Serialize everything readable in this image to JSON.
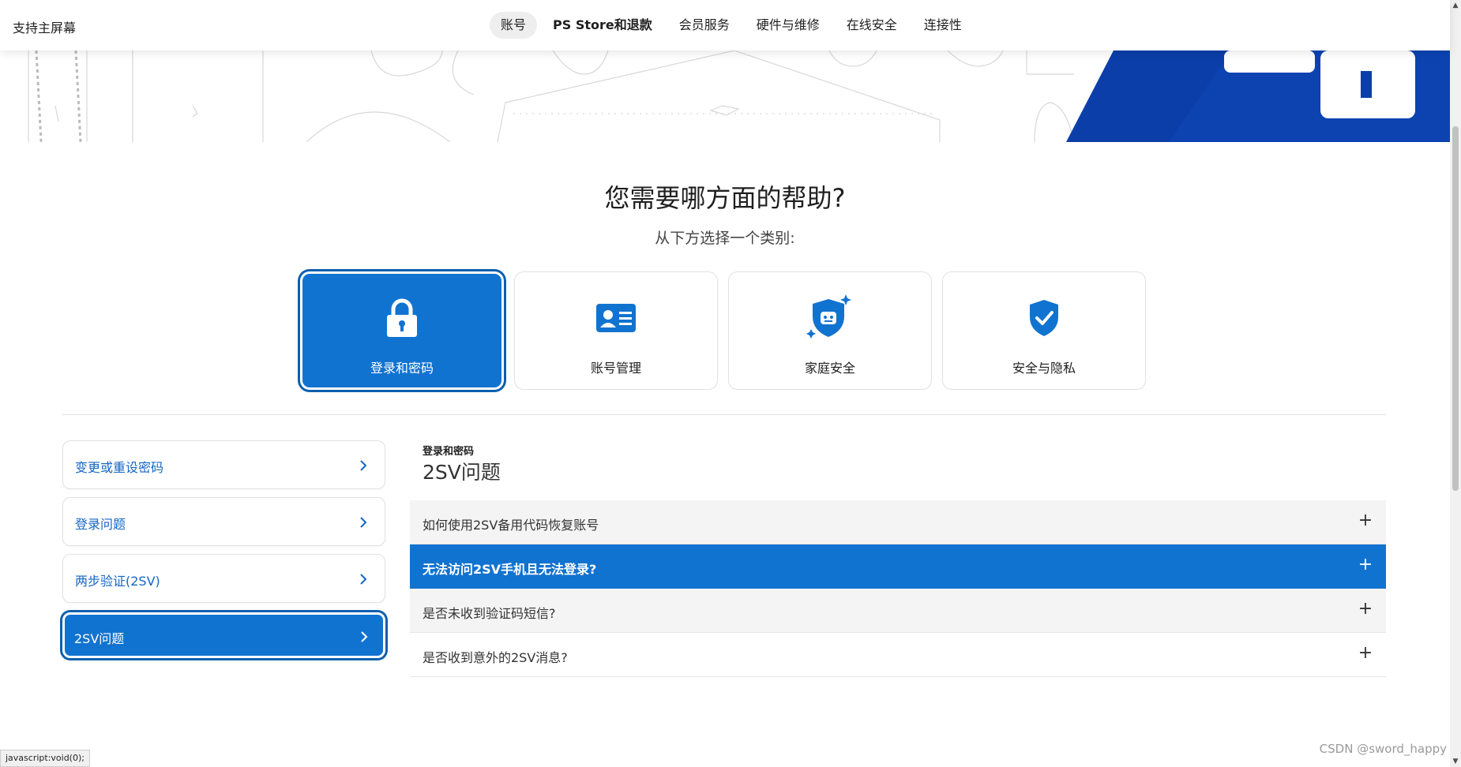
{
  "header": {
    "brand": "支持主屏幕",
    "nav": [
      {
        "label": "账号",
        "active": true
      },
      {
        "label": "PS Store和退款"
      },
      {
        "label": "会员服务"
      },
      {
        "label": "硬件与维修"
      },
      {
        "label": "在线安全"
      },
      {
        "label": "连接性"
      }
    ]
  },
  "main": {
    "title": "您需要哪方面的帮助?",
    "subtitle": "从下方选择一个类别:",
    "categories": [
      {
        "label": "登录和密码",
        "icon": "lock-icon",
        "active": true
      },
      {
        "label": "账号管理",
        "icon": "id-card-icon"
      },
      {
        "label": "家庭安全",
        "icon": "family-shield-icon"
      },
      {
        "label": "安全与隐私",
        "icon": "shield-check-icon"
      }
    ]
  },
  "sidebar": {
    "items": [
      {
        "label": "变更或重设密码"
      },
      {
        "label": "登录问题"
      },
      {
        "label": "两步验证(2SV)"
      },
      {
        "label": "2SV问题",
        "active": true
      }
    ]
  },
  "content": {
    "breadcrumb": "登录和密码",
    "section_title": "2SV问题",
    "faqs": [
      {
        "question": "如何使用2SV备用代码恢复账号"
      },
      {
        "question": "无法访问2SV手机且无法登录?",
        "active": true
      },
      {
        "question": "是否未收到验证码短信?"
      },
      {
        "question": "是否收到意外的2SV消息?"
      }
    ],
    "expand_symbol": "+"
  },
  "status_bar": {
    "url": "javascript:void(0);"
  },
  "watermark": "CSDN @sword_happy",
  "colors": {
    "accent": "#1173d0",
    "accent_dark": "#0c5fae",
    "hero_blue": "#0b3ea8"
  }
}
